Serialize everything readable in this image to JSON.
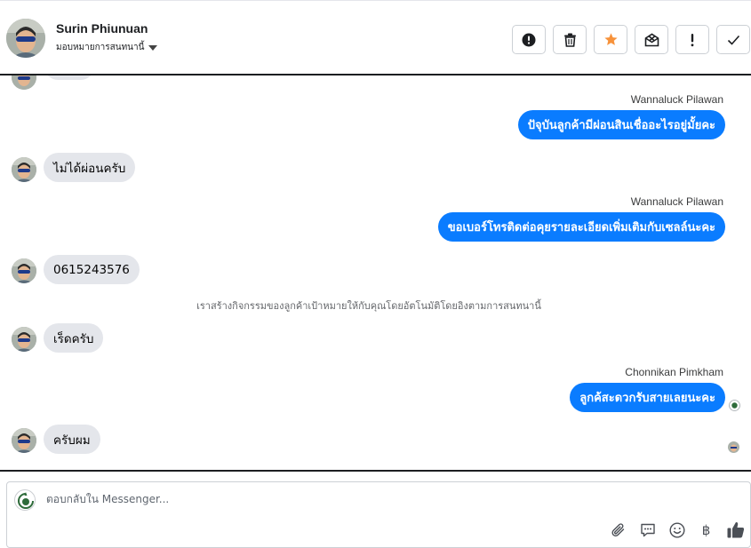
{
  "header": {
    "contact_name": "Surin Phiunuan",
    "assign_label": "มอบหมายการสนทนานี้",
    "actions": [
      {
        "name": "report-spam-button",
        "icon": "exclamation-circle-icon"
      },
      {
        "name": "delete-button",
        "icon": "trash-icon"
      },
      {
        "name": "star-button",
        "icon": "star-icon"
      },
      {
        "name": "mark-unread-button",
        "icon": "envelope-x-icon"
      },
      {
        "name": "mark-important-button",
        "icon": "exclamation-icon"
      },
      {
        "name": "mark-done-button",
        "icon": "checkmark-icon"
      }
    ]
  },
  "messages": {
    "m1_sender": "Wannaluck Pilawan",
    "m1_text": "ปัจุบันลูกค้ามีผ่อนสินเชื่ออะไรอยู่มั้ยคะ",
    "m2_text": "ไม่ได้ผ่อนครับ",
    "m3_sender": "Wannaluck Pilawan",
    "m3_text": "ขอเบอร์โทรติดต่อคุยรายละเอียดเพิ่มเติมกับเซลล์นะคะ",
    "m4_text": "0615243576",
    "system_note": "เราสร้างกิจกรรมของลูกค้าเป้าหมายให้กับคุณโดยอัตโนมัติโดยอิงตามการสนทนานี้",
    "m5_text": "เร็ดครับ",
    "m6_sender": "Chonnikan Pimkham",
    "m6_text": "ลูกค้สะดวกรับสายเลยนะคะ",
    "m7_text": "ครับผม"
  },
  "composer": {
    "placeholder": "ตอบกลับใน Messenger...",
    "tools": [
      "paperclip-icon",
      "speech-bubble-icon",
      "smiley-icon",
      "baht-icon",
      "thumbs-up-icon"
    ],
    "currency_symbol": "฿"
  },
  "colors": {
    "outgoing_bubble": "#0a7cff",
    "incoming_bubble": "#e4e6eb",
    "star": "#f7923a"
  }
}
